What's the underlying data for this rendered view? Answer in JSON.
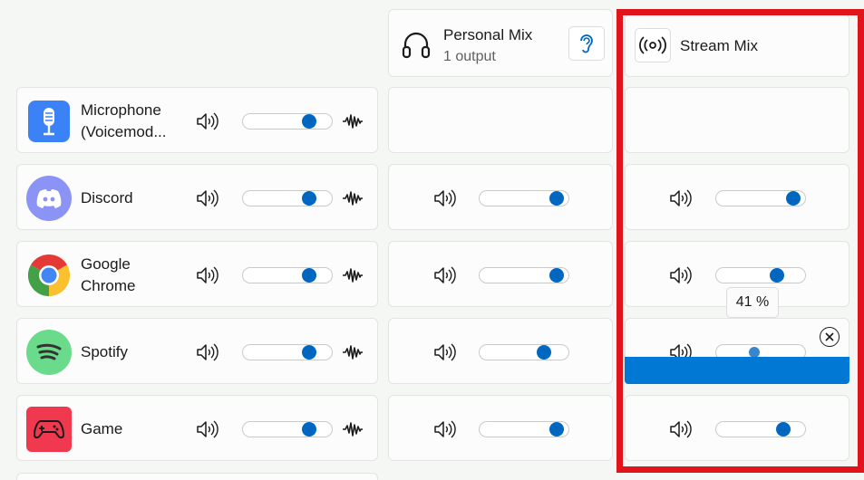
{
  "mixes": {
    "personal": {
      "title": "Personal Mix",
      "subtitle": "1 output"
    },
    "stream": {
      "title": "Stream Mix"
    }
  },
  "sources": [
    {
      "label": "Microphone\n(Voicemod...",
      "icon": "microphone-icon",
      "color": "#3b82f6",
      "source_level": 0.77,
      "personal_level": null,
      "stream_level": null
    },
    {
      "label": "Discord",
      "icon": "discord-icon",
      "color": "#8b93f5",
      "source_level": 0.77,
      "personal_level": 0.92,
      "stream_level": 0.92
    },
    {
      "label": "Google\nChrome",
      "icon": "chrome-icon",
      "color": "#e53935",
      "source_level": 0.77,
      "personal_level": 0.92,
      "stream_level": 0.7
    },
    {
      "label": "Spotify",
      "icon": "spotify-icon",
      "color": "#69db8a",
      "source_level": 0.77,
      "personal_level": 0.75,
      "stream_level": 0.41
    },
    {
      "label": "Game",
      "icon": "gamepad-icon",
      "color": "#f0394e",
      "source_level": 0.77,
      "personal_level": 0.92,
      "stream_level": 0.79
    }
  ],
  "tooltip": {
    "text": "41 %"
  },
  "colors": {
    "accent": "#0067c0",
    "highlight_border": "#e0141a",
    "bar": "#0078d4"
  }
}
